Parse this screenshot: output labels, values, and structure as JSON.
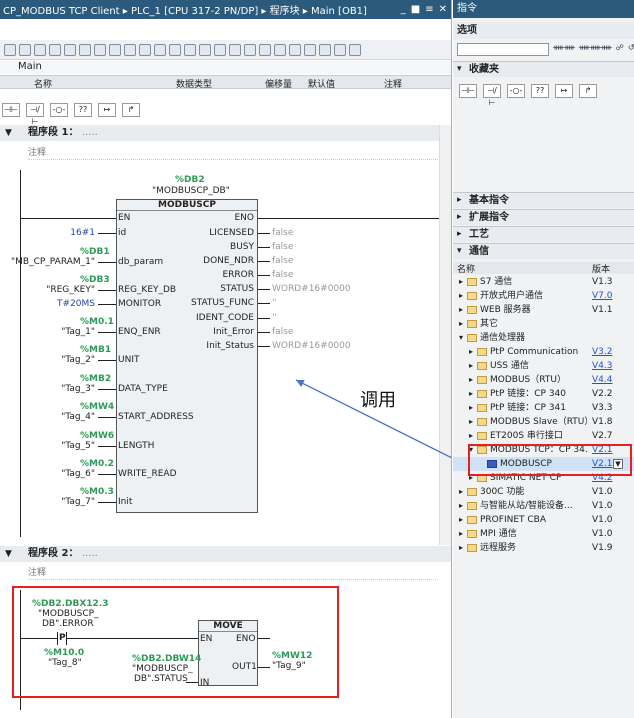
{
  "editor": {
    "breadcrumb": "CP_MODBUS TCP Client ▸ PLC_1 [CPU 317-2 PN/DP] ▸ 程序块 ▸ Main [OB1]",
    "window_controls": [
      "_",
      "■",
      "≡",
      "✕"
    ],
    "interface_title": "Main",
    "columns": [
      "名称",
      "数据类型",
      "偏移量",
      "默认值",
      "注释"
    ],
    "ladder_buttons": [
      "⊣⊢",
      "⊣/⊢",
      "-○-",
      "??",
      "↦",
      "↱"
    ],
    "networks": [
      {
        "title": "程序段 1：",
        "dots": ".....",
        "comment": "注释"
      },
      {
        "title": "程序段 2：",
        "dots": ".....",
        "comment": "注释"
      }
    ],
    "block": {
      "instance_db": "%DB2",
      "instance_db_name": "\"MODBUSCP_DB\"",
      "name": "MODBUSCP",
      "inputs": [
        "EN",
        "id",
        "db_param",
        "REG_KEY_DB",
        "MONITOR",
        "ENQ_ENR",
        "UNIT",
        "DATA_TYPE",
        "START_ADDRESS",
        "LENGTH",
        "WRITE_READ",
        "Init"
      ],
      "outputs": [
        "ENO",
        "LICENSED",
        "BUSY",
        "DONE_NDR",
        "ERROR",
        "STATUS",
        "STATUS_FUNC",
        "IDENT_CODE",
        "Init_Error",
        "Init_Status"
      ],
      "input_vals": [
        {
          "addr": "",
          "val": ""
        },
        {
          "addr": "",
          "val": "16#1"
        },
        {
          "addr": "%DB1",
          "val": "\"MB_CP_PARAM_1\""
        },
        {
          "addr": "%DB3",
          "val": "\"REG_KEY\""
        },
        {
          "addr": "",
          "val": "T#20MS"
        },
        {
          "addr": "%M0.1",
          "val": "\"Tag_1\""
        },
        {
          "addr": "%MB1",
          "val": "\"Tag_2\""
        },
        {
          "addr": "%MB2",
          "val": "\"Tag_3\""
        },
        {
          "addr": "%MW4",
          "val": "\"Tag_4\""
        },
        {
          "addr": "%MW6",
          "val": "\"Tag_5\""
        },
        {
          "addr": "%M0.2",
          "val": "\"Tag_6\""
        },
        {
          "addr": "%M0.3",
          "val": "\"Tag_7\""
        }
      ],
      "output_vals": [
        "",
        "false",
        "false",
        "false",
        "false",
        "WORD#16#0000",
        "''",
        "''",
        "false",
        "WORD#16#0000"
      ]
    },
    "network2": {
      "contact_addr": "%DB2.DBX12.3",
      "contact_name": [
        "\"MODBUSCP_",
        "DB\".ERROR"
      ],
      "contact_symbol": "P",
      "coil_addr": "%M10.0",
      "coil_name": "\"Tag_8\"",
      "move_title": "MOVE",
      "move_en": "EN",
      "move_eno": "ENO",
      "move_in": "IN",
      "move_out": "OUT1",
      "in_addr": "%DB2.DBW14",
      "in_name": [
        "\"MODBUSCP_",
        "DB\".STATUS"
      ],
      "out_addr": "%MW12",
      "out_name": "\"Tag_9\""
    },
    "annotation": "调用"
  },
  "instructions": {
    "title": "指令",
    "options_label": "选项",
    "option_buttons": [
      "ᚔᚔ",
      "ᚔᚔᚔ",
      "☍",
      "↺"
    ],
    "favorites_label": "收藏夹",
    "favorite_buttons": [
      "⊣⊢",
      "⊣/⊢",
      "-○-",
      "??",
      "↦",
      "↱"
    ],
    "sections": [
      "基本指令",
      "扩展指令",
      "工艺",
      "通信"
    ],
    "tree_header": {
      "name": "名称",
      "version": "版本"
    },
    "tree": [
      {
        "level": 0,
        "exp": "▸",
        "name": "S7 通信",
        "ver": "V1.3",
        "link": false
      },
      {
        "level": 0,
        "exp": "▸",
        "name": "开放式用户通信",
        "ver": "V7.0",
        "link": true
      },
      {
        "level": 0,
        "exp": "▸",
        "name": "WEB 服务器",
        "ver": "V1.1",
        "link": false
      },
      {
        "level": 0,
        "exp": "▸",
        "name": "其它",
        "ver": "",
        "link": false
      },
      {
        "level": 0,
        "exp": "▾",
        "name": "通信处理器",
        "ver": "",
        "link": false
      },
      {
        "level": 1,
        "exp": "▸",
        "name": "PtP Communication",
        "ver": "V3.2",
        "link": true
      },
      {
        "level": 1,
        "exp": "▸",
        "name": "USS 通信",
        "ver": "V4.3",
        "link": true
      },
      {
        "level": 1,
        "exp": "▸",
        "name": "MODBUS（RTU）",
        "ver": "V4.4",
        "link": true
      },
      {
        "level": 1,
        "exp": "▸",
        "name": "PtP 链接：CP 340",
        "ver": "V2.2",
        "link": false
      },
      {
        "level": 1,
        "exp": "▸",
        "name": "PtP 链接：CP 341",
        "ver": "V3.3",
        "link": false
      },
      {
        "level": 1,
        "exp": "▸",
        "name": "MODBUS Slave（RTU）",
        "ver": "V1.8",
        "link": false
      },
      {
        "level": 1,
        "exp": "▸",
        "name": "ET200S 串行接口",
        "ver": "V2.7",
        "link": false
      },
      {
        "level": 1,
        "exp": "▾",
        "name": "MODBUS TCP：CP 34...",
        "ver": "V2.1",
        "link": true
      },
      {
        "level": 2,
        "exp": "",
        "name": "MODBUSCP",
        "ver": "V2.1",
        "link": true,
        "selected": true
      },
      {
        "level": 1,
        "exp": "▸",
        "name": "SIMATIC NET CP",
        "ver": "V4.2",
        "link": true
      },
      {
        "level": 0,
        "exp": "▸",
        "name": "300C 功能",
        "ver": "V1.0",
        "link": false
      },
      {
        "level": 0,
        "exp": "▸",
        "name": "与智能从站/智能设备...",
        "ver": "V1.0",
        "link": false
      },
      {
        "level": 0,
        "exp": "▸",
        "name": "PROFINET CBA",
        "ver": "V1.0",
        "link": false
      },
      {
        "level": 0,
        "exp": "▸",
        "name": "MPI 通信",
        "ver": "V1.0",
        "link": false
      },
      {
        "level": 0,
        "exp": "▸",
        "name": "远程服务",
        "ver": "V1.9",
        "link": false
      }
    ]
  },
  "colors": {
    "title_bar": "#2b5a7c",
    "address_green": "#2e9a58",
    "highlight_red": "#e62020",
    "arrow_blue": "#4a74c8"
  }
}
